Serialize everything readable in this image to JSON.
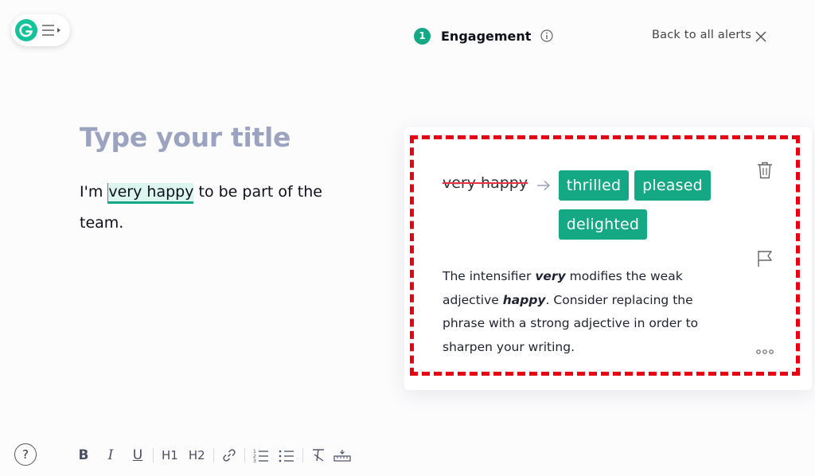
{
  "header": {
    "alert_count": "1",
    "alert_category": "Engagement",
    "back_label": "Back to all alerts"
  },
  "editor": {
    "title_placeholder": "Type your title",
    "body_before": "I'm ",
    "highlighted": "very happy",
    "body_after": " to be part of the team."
  },
  "card": {
    "original": "very happy",
    "suggestions": [
      "thrilled",
      "pleased",
      "delighted"
    ],
    "explanation": {
      "part1": "The intensifier ",
      "bold1": "very",
      "part2": " modifies the weak adjective ",
      "bold2": "happy",
      "part3": ". Consider replacing the phrase with a strong adjective in order to sharpen your writing."
    }
  },
  "toolbar": {
    "bold": "B",
    "italic": "I",
    "underline": "U",
    "h1": "H1",
    "h2": "H2",
    "help": "?"
  },
  "colors": {
    "accent": "#15a884",
    "highlight_bg": "#dcf5ef",
    "annotation_border": "#e60012",
    "title_placeholder": "#9ba3c0"
  },
  "icons": [
    "grammarly-logo-icon",
    "menu-icon",
    "info-icon",
    "close-icon",
    "arrow-right-icon",
    "trash-icon",
    "flag-icon",
    "more-icon",
    "link-icon",
    "ordered-list-icon",
    "bullet-list-icon",
    "clear-format-icon",
    "ruler-icon",
    "help-icon"
  ]
}
